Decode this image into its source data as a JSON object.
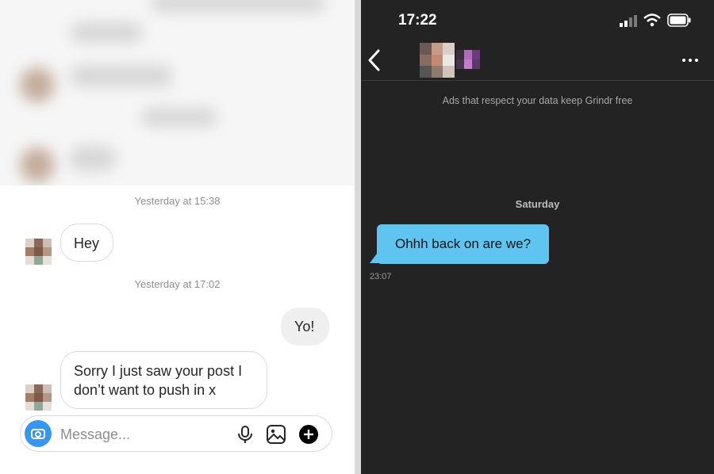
{
  "left_chat": {
    "timestamp_1": "Yesterday at 15:38",
    "msg_hey": "Hey",
    "timestamp_2": "Yesterday at 17:02",
    "msg_yo": "Yo!",
    "msg_sorry_line1": "Sorry I just saw your post I",
    "msg_sorry_line2": "don’t want to push in x",
    "composer": {
      "placeholder": "Message...",
      "accent": "#3797f0"
    }
  },
  "right_chat": {
    "status_time": "17:22",
    "ads_notice": "Ads that respect your data keep Grindr free",
    "day_label": "Saturday",
    "message": "Ohhh back on are we?",
    "message_time": "23:07",
    "bubble_color": "#5fc4f0"
  },
  "icons": [
    "camera-icon",
    "microphone-icon",
    "image-icon",
    "plus-circle-icon",
    "back-chevron-icon",
    "signal-icon",
    "wifi-icon",
    "battery-icon",
    "more-icon"
  ]
}
